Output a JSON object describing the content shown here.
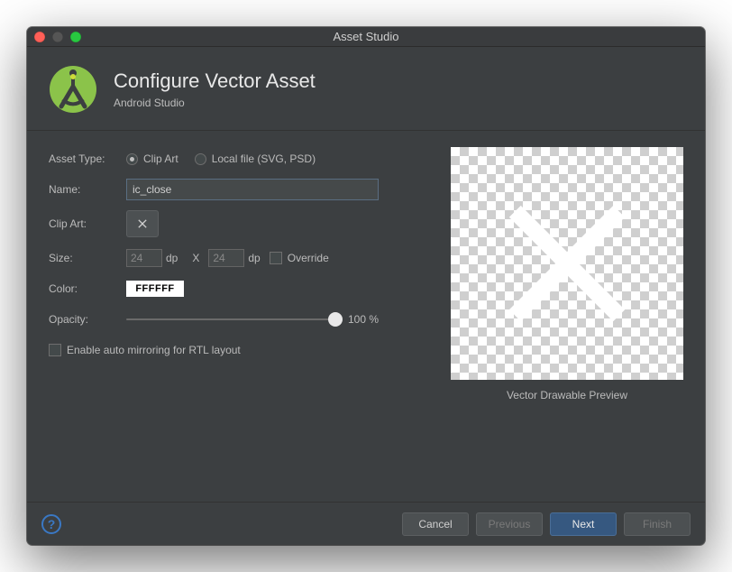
{
  "window": {
    "title": "Asset Studio"
  },
  "header": {
    "title": "Configure Vector Asset",
    "subtitle": "Android Studio"
  },
  "labels": {
    "asset_type": "Asset Type:",
    "name": "Name:",
    "clip_art": "Clip Art:",
    "size": "Size:",
    "color": "Color:",
    "opacity": "Opacity:"
  },
  "asset_type": {
    "clip_art": "Clip Art",
    "local_file": "Local file (SVG, PSD)"
  },
  "name_value": "ic_close",
  "size": {
    "w": "24",
    "h": "24",
    "unit_w": "dp",
    "sep": "X",
    "unit_h": "dp",
    "override": "Override"
  },
  "color": {
    "hex": "FFFFFF"
  },
  "opacity": {
    "percent": 100,
    "display": "100 %"
  },
  "rtl": {
    "label": "Enable auto mirroring for RTL layout"
  },
  "preview": {
    "caption": "Vector Drawable Preview"
  },
  "buttons": {
    "cancel": "Cancel",
    "previous": "Previous",
    "next": "Next",
    "finish": "Finish"
  },
  "icons": {
    "logo": "android-studio-logo",
    "clipart_x": "close-icon",
    "help": "?"
  }
}
